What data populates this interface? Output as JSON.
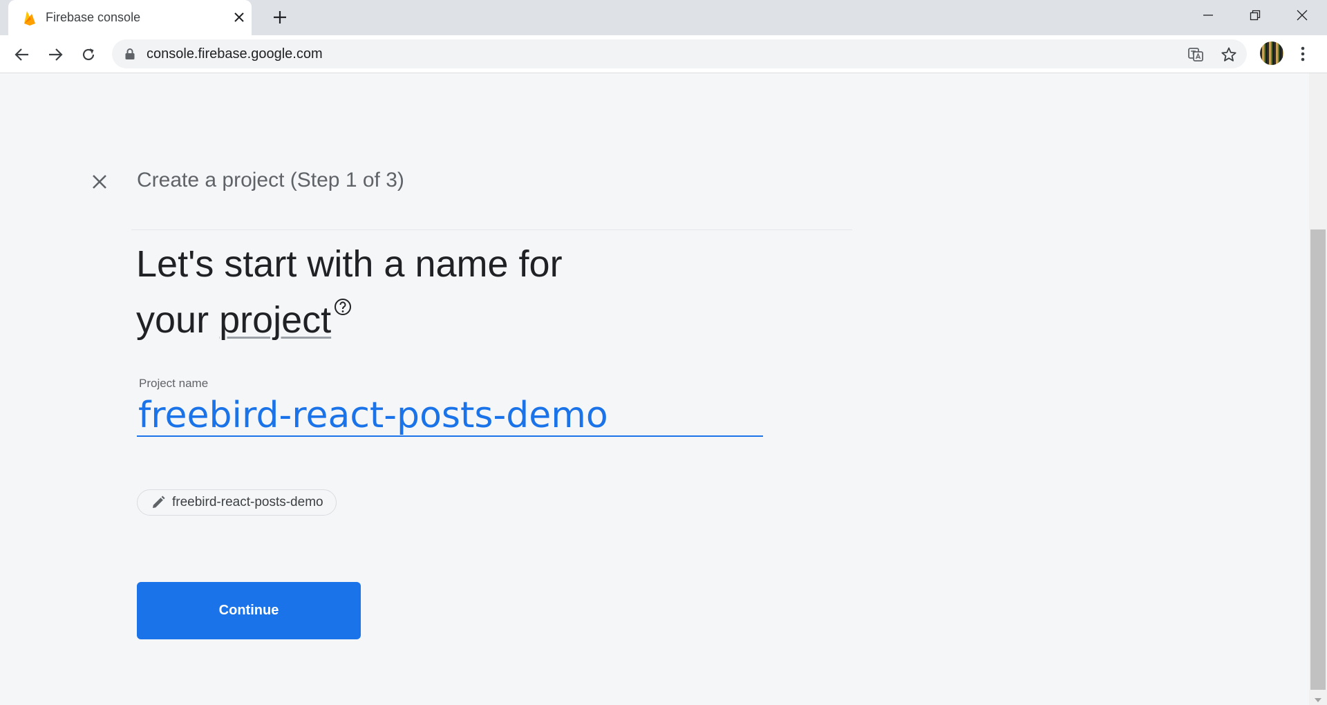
{
  "browser": {
    "tab": {
      "title": "Firebase console",
      "favicon": "firebase-flame-icon"
    },
    "address_bar": {
      "url": "console.firebase.google.com"
    },
    "icons": [
      "back-icon",
      "forward-icon",
      "reload-icon",
      "lock-icon",
      "translate-icon",
      "star-icon",
      "avatar",
      "more-icon"
    ]
  },
  "dialog": {
    "step_title": "Create a project (Step 1 of 3)",
    "heading_line1": "Let's start with a name for",
    "heading_line2_prefix": "your ",
    "heading_line2_link": "project",
    "project_field": {
      "label": "Project name",
      "value": "freebird-react-posts-demo"
    },
    "project_id_chip": "freebird-react-posts-demo",
    "continue_label": "Continue"
  },
  "colors": {
    "accent": "#1a73e8",
    "background": "#f5f6f8",
    "firebase_flame": "#ffa000"
  }
}
